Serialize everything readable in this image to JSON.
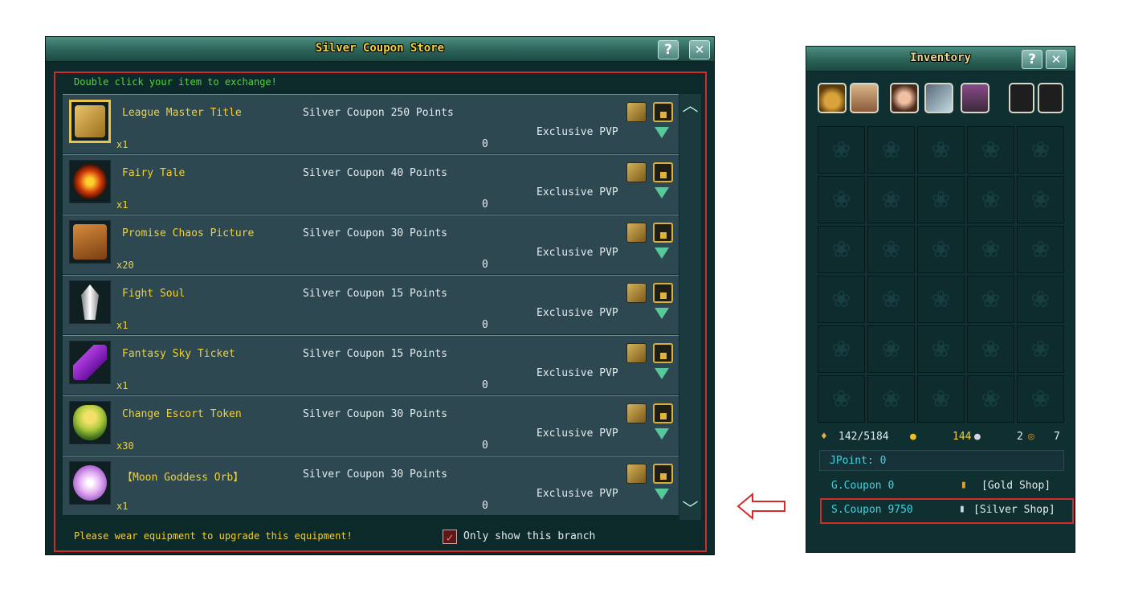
{
  "store": {
    "title": "Silver Coupon Store",
    "hint": "Double click your item to exchange!",
    "help_label": "?",
    "close_label": "✕",
    "items": [
      {
        "name": "League Master Title",
        "price": "Silver Coupon 250 Points",
        "qty": "x1",
        "owned": "0",
        "tag": "Exclusive PVP",
        "icon": "scroll-icon"
      },
      {
        "name": "Fairy Tale",
        "price": "Silver Coupon 40 Points",
        "qty": "x1",
        "owned": "0",
        "tag": "Exclusive PVP",
        "icon": "fire-orb-icon"
      },
      {
        "name": "Promise Chaos Picture",
        "price": "Silver Coupon 30 Points",
        "qty": "x20",
        "owned": "0",
        "tag": "Exclusive PVP",
        "icon": "map-scroll-icon"
      },
      {
        "name": "Fight Soul",
        "price": "Silver Coupon 15 Points",
        "qty": "x1",
        "owned": "0",
        "tag": "Exclusive PVP",
        "icon": "crystal-icon"
      },
      {
        "name": "Fantasy Sky Ticket",
        "price": "Silver Coupon 15 Points",
        "qty": "x1",
        "owned": "0",
        "tag": "Exclusive PVP",
        "icon": "ticket-icon"
      },
      {
        "name": "Change Escort Token",
        "price": "Silver Coupon 30 Points",
        "qty": "x30",
        "owned": "0",
        "tag": "Exclusive PVP",
        "icon": "token-icon"
      },
      {
        "name": "【Moon Goddess Orb】",
        "price": "Silver Coupon 30 Points",
        "qty": "x1",
        "owned": "0",
        "tag": "Exclusive PVP",
        "icon": "orb-icon"
      }
    ],
    "footer_text": "Please wear equipment to upgrade this equipment!",
    "checkbox_label": "Only show this branch",
    "checkbox_checked": true
  },
  "inventory": {
    "title": "Inventory",
    "help_label": "?",
    "close_label": "✕",
    "tabs": [
      "bag-icon",
      "scroll-list-icon",
      "armor-icon",
      "sword-icon",
      "boot-icon",
      "lock-icon",
      "unlock-icon"
    ],
    "capacity": "142/5184",
    "gold": "144",
    "silver": "2",
    "copper": "7",
    "jpoint": "JPoint: 0",
    "gold_coupon": "G.Coupon 0",
    "gold_shop": "[Gold Shop]",
    "silver_coupon": "S.Coupon 9750",
    "silver_shop": "[Silver Shop]"
  },
  "colors": {
    "accent_yellow": "#f0d039",
    "highlight_red": "#d62a2a",
    "hint_green": "#4ddc2c"
  }
}
